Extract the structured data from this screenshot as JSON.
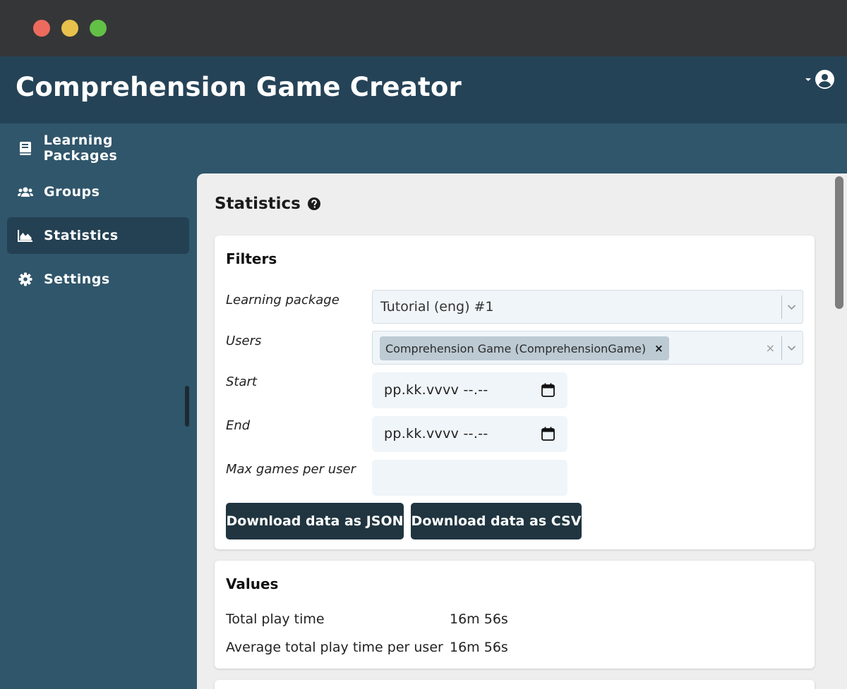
{
  "app": {
    "title": "Comprehension Game Creator"
  },
  "sidebar": {
    "items": [
      {
        "label": "Learning Packages",
        "icon": "book-icon"
      },
      {
        "label": "Groups",
        "icon": "users-icon"
      },
      {
        "label": "Statistics",
        "icon": "chart-area-icon",
        "active": true
      },
      {
        "label": "Settings",
        "icon": "gear-icon"
      }
    ]
  },
  "page": {
    "title": "Statistics"
  },
  "filters": {
    "title": "Filters",
    "learning_package": {
      "label": "Learning package",
      "value": "Tutorial (eng) #1"
    },
    "users": {
      "label": "Users",
      "chip": "Comprehension Game (ComprehensionGame)",
      "chip_remove": "×",
      "clear": "×"
    },
    "start": {
      "label": "Start",
      "value": "pp.kk.vvvv --.--"
    },
    "end": {
      "label": "End",
      "value": "pp.kk.vvvv --.--"
    },
    "max_games": {
      "label": "Max games per user",
      "value": ""
    },
    "download_json": "Download data as JSON",
    "download_csv": "Download data as CSV"
  },
  "values": {
    "title": "Values",
    "rows": [
      {
        "label": "Total play time",
        "value": "16m 56s"
      },
      {
        "label": "Average total play time per user",
        "value": "16m 56s"
      }
    ]
  },
  "colors": {
    "header": "#254357",
    "sidebar": "#30566b",
    "active_nav": "#244053",
    "button": "#203540"
  }
}
